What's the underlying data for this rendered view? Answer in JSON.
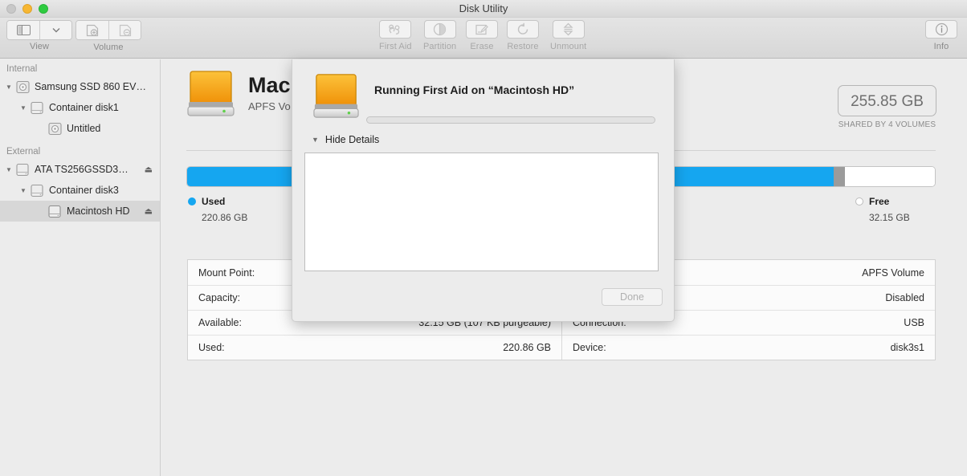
{
  "window": {
    "title": "Disk Utility",
    "traffic": {
      "close": "close-button",
      "minimize": "minimize-button",
      "maximize": "zoom-button"
    }
  },
  "toolbar": {
    "view_caption": "View",
    "volume_caption": "Volume",
    "first_aid": "First Aid",
    "partition": "Partition",
    "erase": "Erase",
    "restore": "Restore",
    "unmount": "Unmount",
    "info": "Info"
  },
  "sidebar": {
    "sections": [
      {
        "header": "Internal",
        "items": [
          {
            "label": "Samsung SSD 860 EV…",
            "indent": 0,
            "triangle": "▼",
            "icon": "internal-disk-icon",
            "eject": false,
            "selected": false
          },
          {
            "label": "Container disk1",
            "indent": 1,
            "triangle": "▼",
            "icon": "volume-icon",
            "eject": false,
            "selected": false
          },
          {
            "label": "Untitled",
            "indent": 2,
            "triangle": "",
            "icon": "internal-disk-icon",
            "eject": false,
            "selected": false
          }
        ]
      },
      {
        "header": "External",
        "items": [
          {
            "label": "ATA TS256GSSD3…",
            "indent": 0,
            "triangle": "▼",
            "icon": "volume-icon",
            "eject": true,
            "selected": false
          },
          {
            "label": "Container disk3",
            "indent": 1,
            "triangle": "▼",
            "icon": "volume-icon",
            "eject": false,
            "selected": false
          },
          {
            "label": "Macintosh HD",
            "indent": 2,
            "triangle": "",
            "icon": "volume-icon",
            "eject": true,
            "selected": true
          }
        ]
      }
    ],
    "eject_glyph": "⏏"
  },
  "main": {
    "volume_name": "Mac",
    "volume_subtitle": "APFS Vo",
    "capacity_value": "255.85 GB",
    "capacity_note": "SHARED BY 4 VOLUMES",
    "legend": {
      "used": {
        "name": "Used",
        "value": "220.86 GB",
        "color": "#15a6f0"
      },
      "free": {
        "name": "Free",
        "value": "32.15 GB",
        "color": "#ffffff"
      }
    },
    "bar": {
      "used_percent": 86.5,
      "other_percent": 1.5,
      "free_percent": 12.0
    },
    "info_left": [
      {
        "key": "Mount Point:",
        "value": ""
      },
      {
        "key": "Capacity:",
        "value": ""
      },
      {
        "key": "Available:",
        "value": "32.15 GB (107 KB purgeable)"
      },
      {
        "key": "Used:",
        "value": "220.86 GB"
      }
    ],
    "info_right": [
      {
        "key": "",
        "value": "APFS Volume"
      },
      {
        "key": "",
        "value": "Disabled"
      },
      {
        "key": "Connection:",
        "value": "USB"
      },
      {
        "key": "Device:",
        "value": "disk3s1"
      }
    ]
  },
  "sheet": {
    "title": "Running First Aid on “Macintosh HD”",
    "disclosure_label": "Hide Details",
    "disclosure_triangle": "▼",
    "details_text": "",
    "done_label": "Done",
    "progress_percent": 0
  }
}
